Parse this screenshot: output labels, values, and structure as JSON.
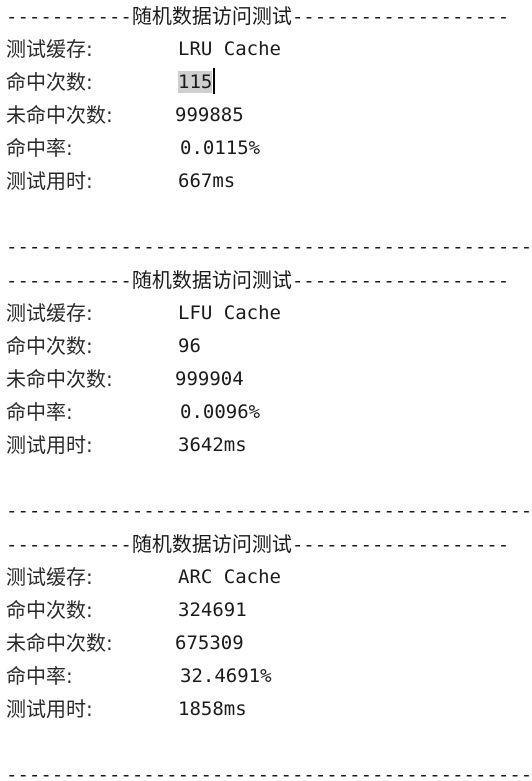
{
  "header_dashes_left": "-----------",
  "header_dashes_right": "-------------------",
  "separator_line": "--------------------------------------------------",
  "labels": {
    "cache": "测试缓存:",
    "hits": "命中次数:",
    "misses": "未命中次数:",
    "rate": "命中率:",
    "time": "测试用时:"
  },
  "blocks": [
    {
      "title": "随机数据访问测试",
      "cache": "LRU Cache",
      "hits": "115",
      "misses": "999885",
      "rate": "0.0115%",
      "time": "667ms"
    },
    {
      "title": "随机数据访问测试",
      "cache": "LFU Cache",
      "hits": "96",
      "misses": "999904",
      "rate": "0.0096%",
      "time": "3642ms"
    },
    {
      "title": "随机数据访问测试",
      "cache": "ARC Cache",
      "hits": "324691",
      "misses": "675309",
      "rate": "32.4691%",
      "time": "1858ms"
    }
  ]
}
